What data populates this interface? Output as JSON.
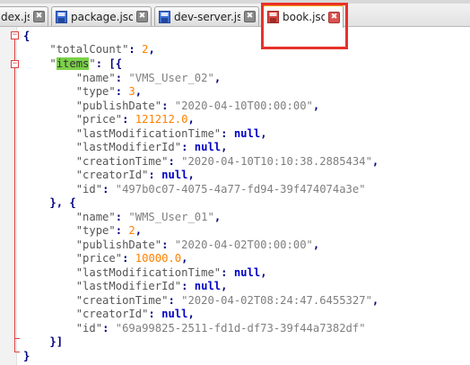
{
  "tabs": [
    {
      "label": "dex.js",
      "active": false
    },
    {
      "label": "package.json",
      "active": false
    },
    {
      "label": "dev-server.js",
      "active": false
    },
    {
      "label": "book.json",
      "active": true
    }
  ],
  "close_glyph": "✖",
  "json": {
    "totalCount_key": "\"totalCount\"",
    "totalCount_value": "2",
    "items_key": "items",
    "items": [
      {
        "name": "\"VMS_User_02\"",
        "type": "3",
        "publishDate": "\"2020-04-10T00:00:00\"",
        "price": "121212.0",
        "lastModificationTime": "null",
        "lastModifierId": "null",
        "creationTime": "\"2020-04-10T10:10:38.2885434\"",
        "creatorId": "null",
        "id": "\"497b0c07-4075-4a77-fd94-39f474074a3e\""
      },
      {
        "name": "\"WMS_User_01\"",
        "type": "2",
        "publishDate": "\"2020-04-02T00:00:00\"",
        "price": "10000.0",
        "lastModificationTime": "null",
        "lastModifierId": "null",
        "creationTime": "\"2020-04-02T08:24:47.6455327\"",
        "creatorId": "null",
        "id": "\"69a99825-2511-fd1d-df73-39f44a7382df\""
      }
    ]
  },
  "colors": {
    "highlight_box": "#e8312a",
    "active_tab_accent": "#f4a300",
    "fold_marker": "#e04040",
    "selection": "#7bd148",
    "number": "#ff8000",
    "keyword": "#0000c8"
  }
}
